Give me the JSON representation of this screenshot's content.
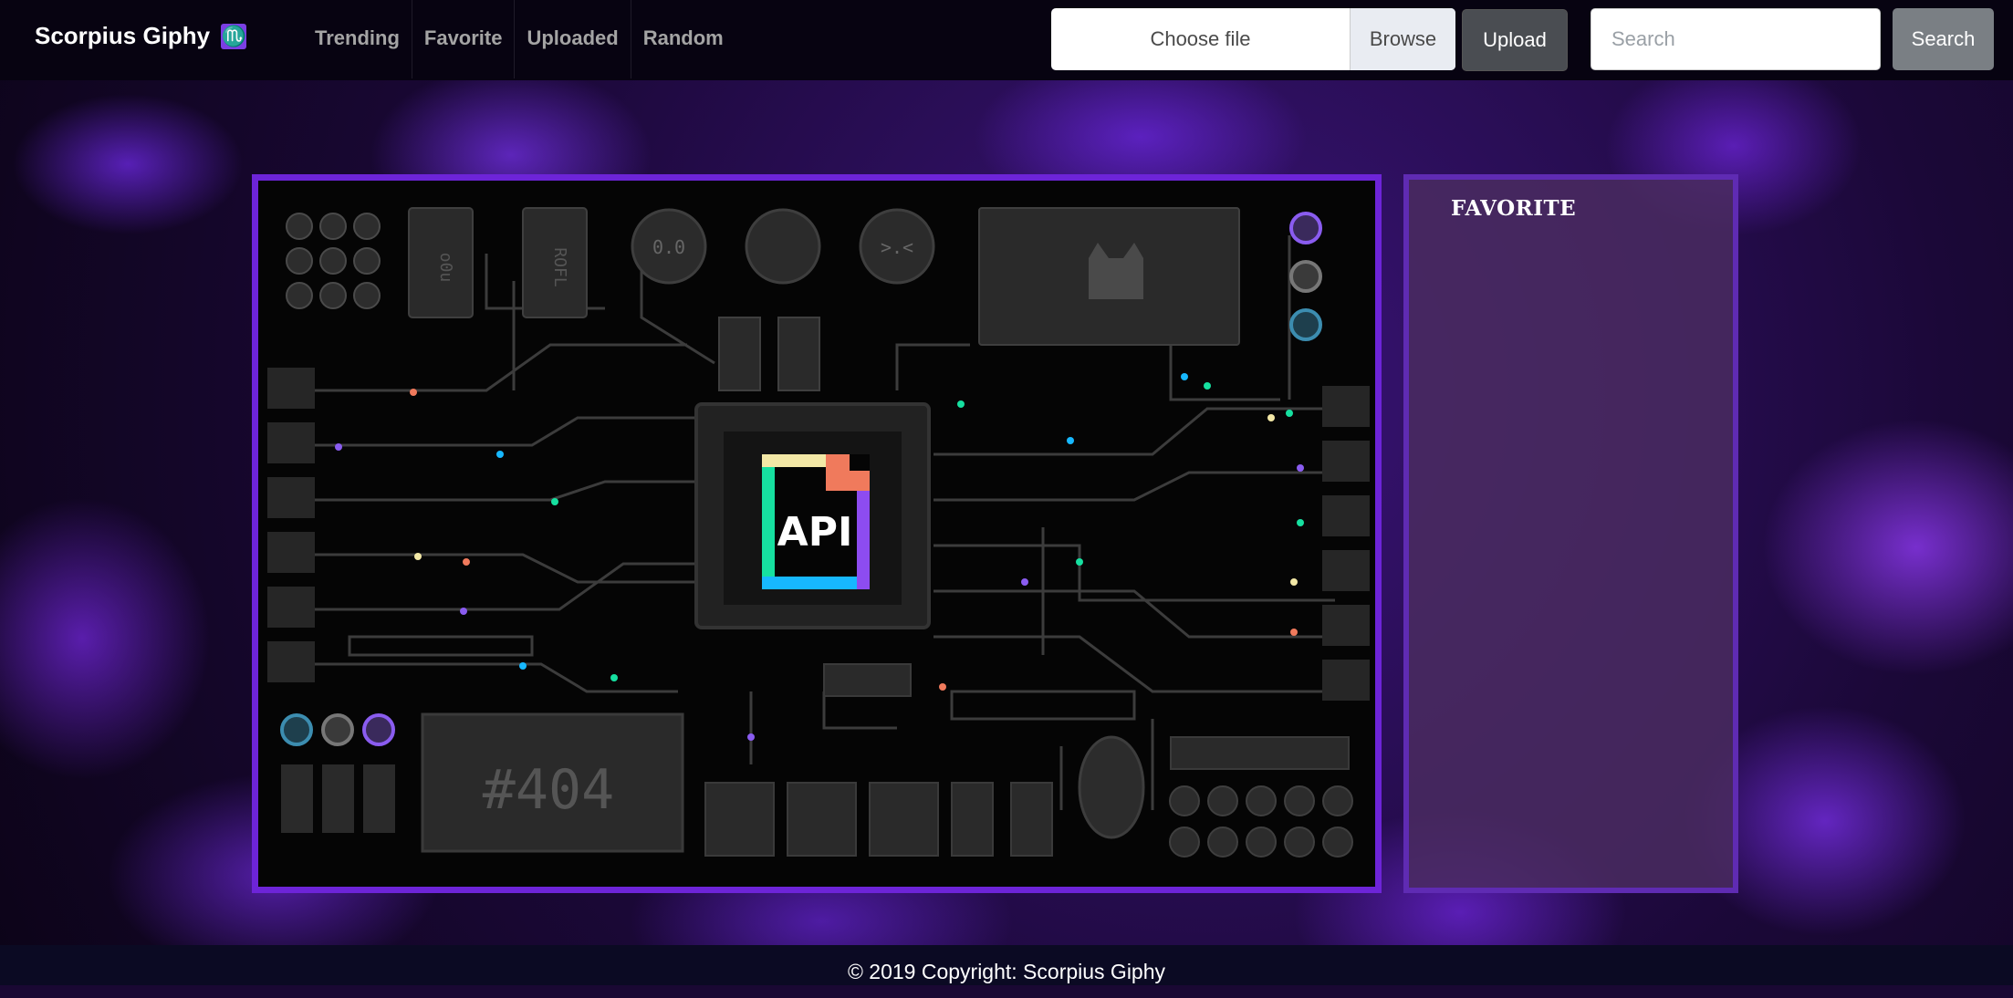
{
  "brand": {
    "name": "Scorpius Giphy",
    "icon": "scorpius-zodiac-icon",
    "icon_glyph": "♏"
  },
  "nav": {
    "items": [
      "Trending",
      "Favorite",
      "Uploaded",
      "Random"
    ]
  },
  "upload": {
    "file_label": "Choose file",
    "browse_label": "Browse",
    "button_label": "Upload"
  },
  "search": {
    "placeholder": "Search",
    "value": "",
    "button_label": "Search"
  },
  "gif": {
    "api_label": "API",
    "chip_labels": [
      "o0u",
      "ROFL"
    ],
    "status_code": "#404"
  },
  "favorite": {
    "title": "FAVORITE"
  },
  "footer": {
    "text": "© 2019 Copyright: Scorpius Giphy"
  },
  "colors": {
    "accent": "#6d24d8",
    "navbar": "#070311",
    "footer": "#0b0a23"
  }
}
